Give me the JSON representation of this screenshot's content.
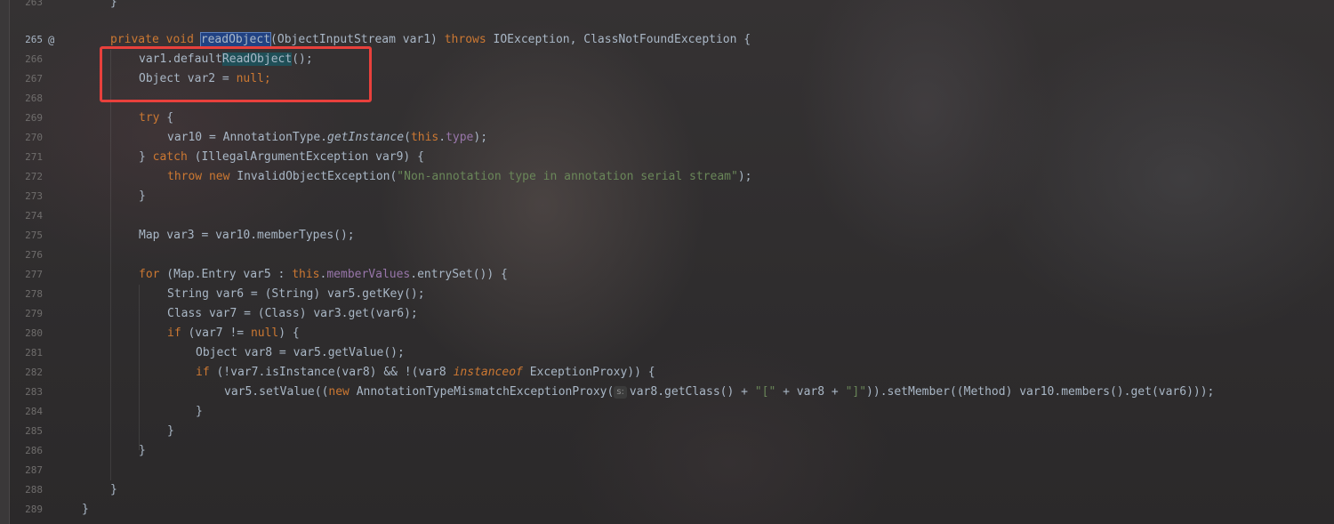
{
  "editor": {
    "override_marker": "@",
    "lines": [
      {
        "n": "263",
        "text": "    }"
      },
      {
        "n": "265",
        "text": "private void readObject(ObjectInputStream var1) throws IOException, ClassNotFoundException {"
      },
      {
        "n": "266",
        "text": "var1.defaultReadObject();"
      },
      {
        "n": "267",
        "text": "Object var2 = null;"
      },
      {
        "n": "268",
        "text": ""
      },
      {
        "n": "269",
        "text": "try {"
      },
      {
        "n": "270",
        "text": "var10 = AnnotationType.getInstance(this.type);"
      },
      {
        "n": "271",
        "text": "} catch (IllegalArgumentException var9) {"
      },
      {
        "n": "272",
        "text": "throw new InvalidObjectException(\"Non-annotation type in annotation serial stream\");"
      },
      {
        "n": "273",
        "text": "}"
      },
      {
        "n": "274",
        "text": ""
      },
      {
        "n": "275",
        "text": "Map var3 = var10.memberTypes();"
      },
      {
        "n": "276",
        "text": ""
      },
      {
        "n": "277",
        "text": "for (Map.Entry var5 : this.memberValues.entrySet()) {"
      },
      {
        "n": "278",
        "text": "String var6 = (String) var5.getKey();"
      },
      {
        "n": "279",
        "text": "Class var7 = (Class) var3.get(var6);"
      },
      {
        "n": "280",
        "text": "if (var7 != null) {"
      },
      {
        "n": "281",
        "text": "Object var8 = var5.getValue();"
      },
      {
        "n": "282",
        "text": "if (!var7.isInstance(var8) && !(var8 instanceof ExceptionProxy)) {"
      },
      {
        "n": "283",
        "text": "var5.setValue((new AnnotationTypeMismatchExceptionProxy( s: var8.getClass() + \"[\" + var8 + \"]\")).setMember((Method) var10.members().get(var6)));"
      },
      {
        "n": "284",
        "text": "}"
      },
      {
        "n": "285",
        "text": "}"
      },
      {
        "n": "286",
        "text": "}"
      },
      {
        "n": "287",
        "text": ""
      },
      {
        "n": "288",
        "text": "}"
      },
      {
        "n": "289",
        "text": "}"
      }
    ],
    "tokens": {
      "l265_private": "private",
      "l265_void": "void",
      "l265_method": "readObject",
      "l265_params": "(ObjectInputStream var1) ",
      "l265_throws": "throws",
      "l265_exc": " IOException, ClassNotFoundException {",
      "l266_pre": "var1.default",
      "l266_hl": "ReadObject",
      "l266_post": "();",
      "l267_pre": "Object var2 = ",
      "l267_null": "null",
      "l267_post": ";",
      "l269_try": "try",
      "l269_post": " {",
      "l270_pre": "var10 = AnnotationType.",
      "l270_call": "getInstance",
      "l270_mid": "(",
      "l270_this": "this",
      "l270_dot": ".",
      "l270_field": "type",
      "l270_post": ");",
      "l271_pre": "} ",
      "l271_catch": "catch",
      "l271_post": " (IllegalArgumentException var9) {",
      "l272_throw": "throw",
      "l272_new": "new",
      "l272_cls": " InvalidObjectException(",
      "l272_str": "\"Non-annotation type in annotation serial stream\"",
      "l272_post": ");",
      "l273": "}",
      "l275": "Map var3 = var10.memberTypes();",
      "l277_for": "for",
      "l277_mid": " (Map.Entry var5 : ",
      "l277_this": "this",
      "l277_dot": ".",
      "l277_field": "memberValues",
      "l277_post": ".entrySet()) {",
      "l278": "String var6 = (String) var5.getKey();",
      "l279": "Class var7 = (Class) var3.get(var6);",
      "l280_if": "if",
      "l280_mid": " (var7 != ",
      "l280_null": "null",
      "l280_post": ") {",
      "l281": "Object var8 = var5.getValue();",
      "l282_if": "if",
      "l282_mid": " (!var7.isInstance(var8) && !(var8 ",
      "l282_instanceof": "instanceof",
      "l282_post": " ExceptionProxy)) {",
      "l283_pre": "var5.setValue((",
      "l283_new": "new",
      "l283_cls": " AnnotationTypeMismatchExceptionProxy(",
      "l283_hint": "s:",
      "l283_mid": "var8.getClass() + ",
      "l283_str1": "\"[\"",
      "l283_mid2": " + var8 + ",
      "l283_str2": "\"]\"",
      "l283_post": ")).setMember((Method) var10.members().get(var6)));",
      "l284": "}",
      "l285": "}",
      "l286": "}",
      "l288": "}",
      "l289": "}",
      "l263": "}"
    }
  }
}
